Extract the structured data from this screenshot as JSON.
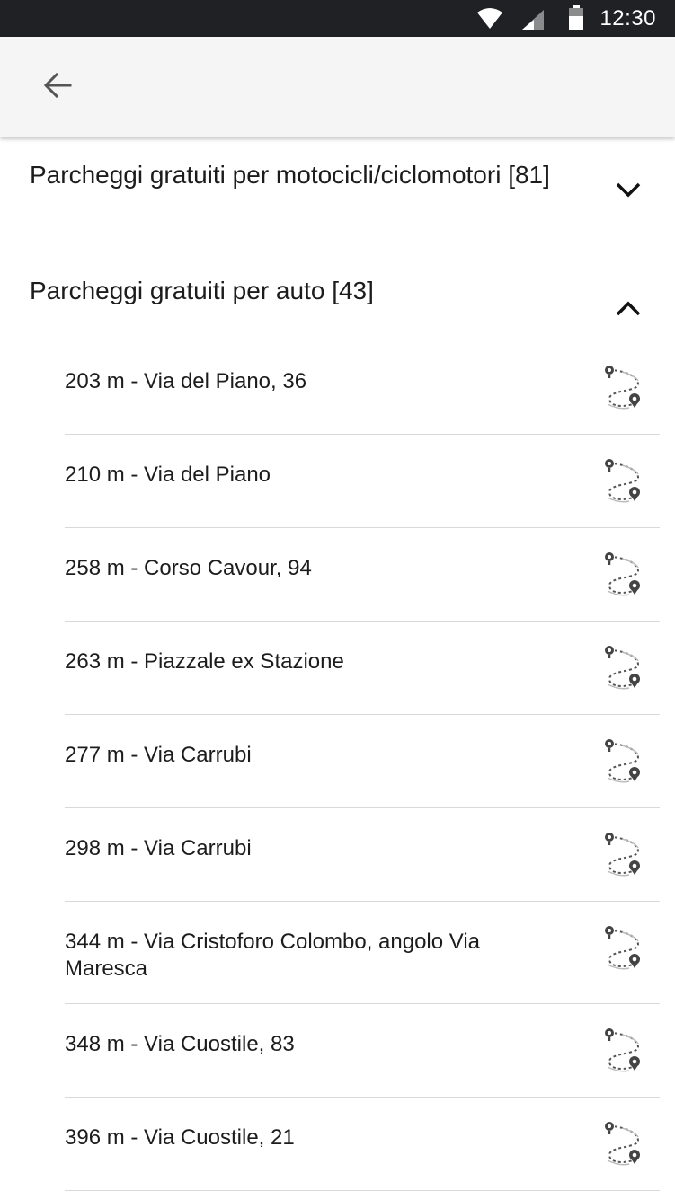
{
  "status_bar": {
    "time": "12:30"
  },
  "app_bar": {
    "back_icon": "arrow-left-icon"
  },
  "sections": [
    {
      "title": "Parcheggi gratuiti per motocicli/ciclomotori [81]",
      "state": "collapsed",
      "toggle_icon": "chevron-down-icon"
    },
    {
      "title": "Parcheggi gratuiti per auto [43]",
      "state": "expanded",
      "toggle_icon": "chevron-up-icon"
    }
  ],
  "items": [
    {
      "label": "203 m - Via del Piano, 36",
      "icon": "route-icon"
    },
    {
      "label": "210 m - Via del Piano",
      "icon": "route-icon"
    },
    {
      "label": "258 m - Corso Cavour, 94",
      "icon": "route-icon"
    },
    {
      "label": "263 m - Piazzale ex Stazione",
      "icon": "route-icon"
    },
    {
      "label": "277 m - Via Carrubi",
      "icon": "route-icon"
    },
    {
      "label": "298 m - Via Carrubi",
      "icon": "route-icon"
    },
    {
      "label": "344 m - Via Cristoforo Colombo, angolo Via Maresca",
      "icon": "route-icon"
    },
    {
      "label": "348 m - Via Cuostile, 83",
      "icon": "route-icon"
    },
    {
      "label": "396 m - Via Cuostile, 21",
      "icon": "route-icon"
    }
  ],
  "colors": {
    "status_bar": "#1f2124",
    "app_bar": "#f5f5f5",
    "text": "#1c1c1c",
    "divider": "#d9d9d9"
  }
}
